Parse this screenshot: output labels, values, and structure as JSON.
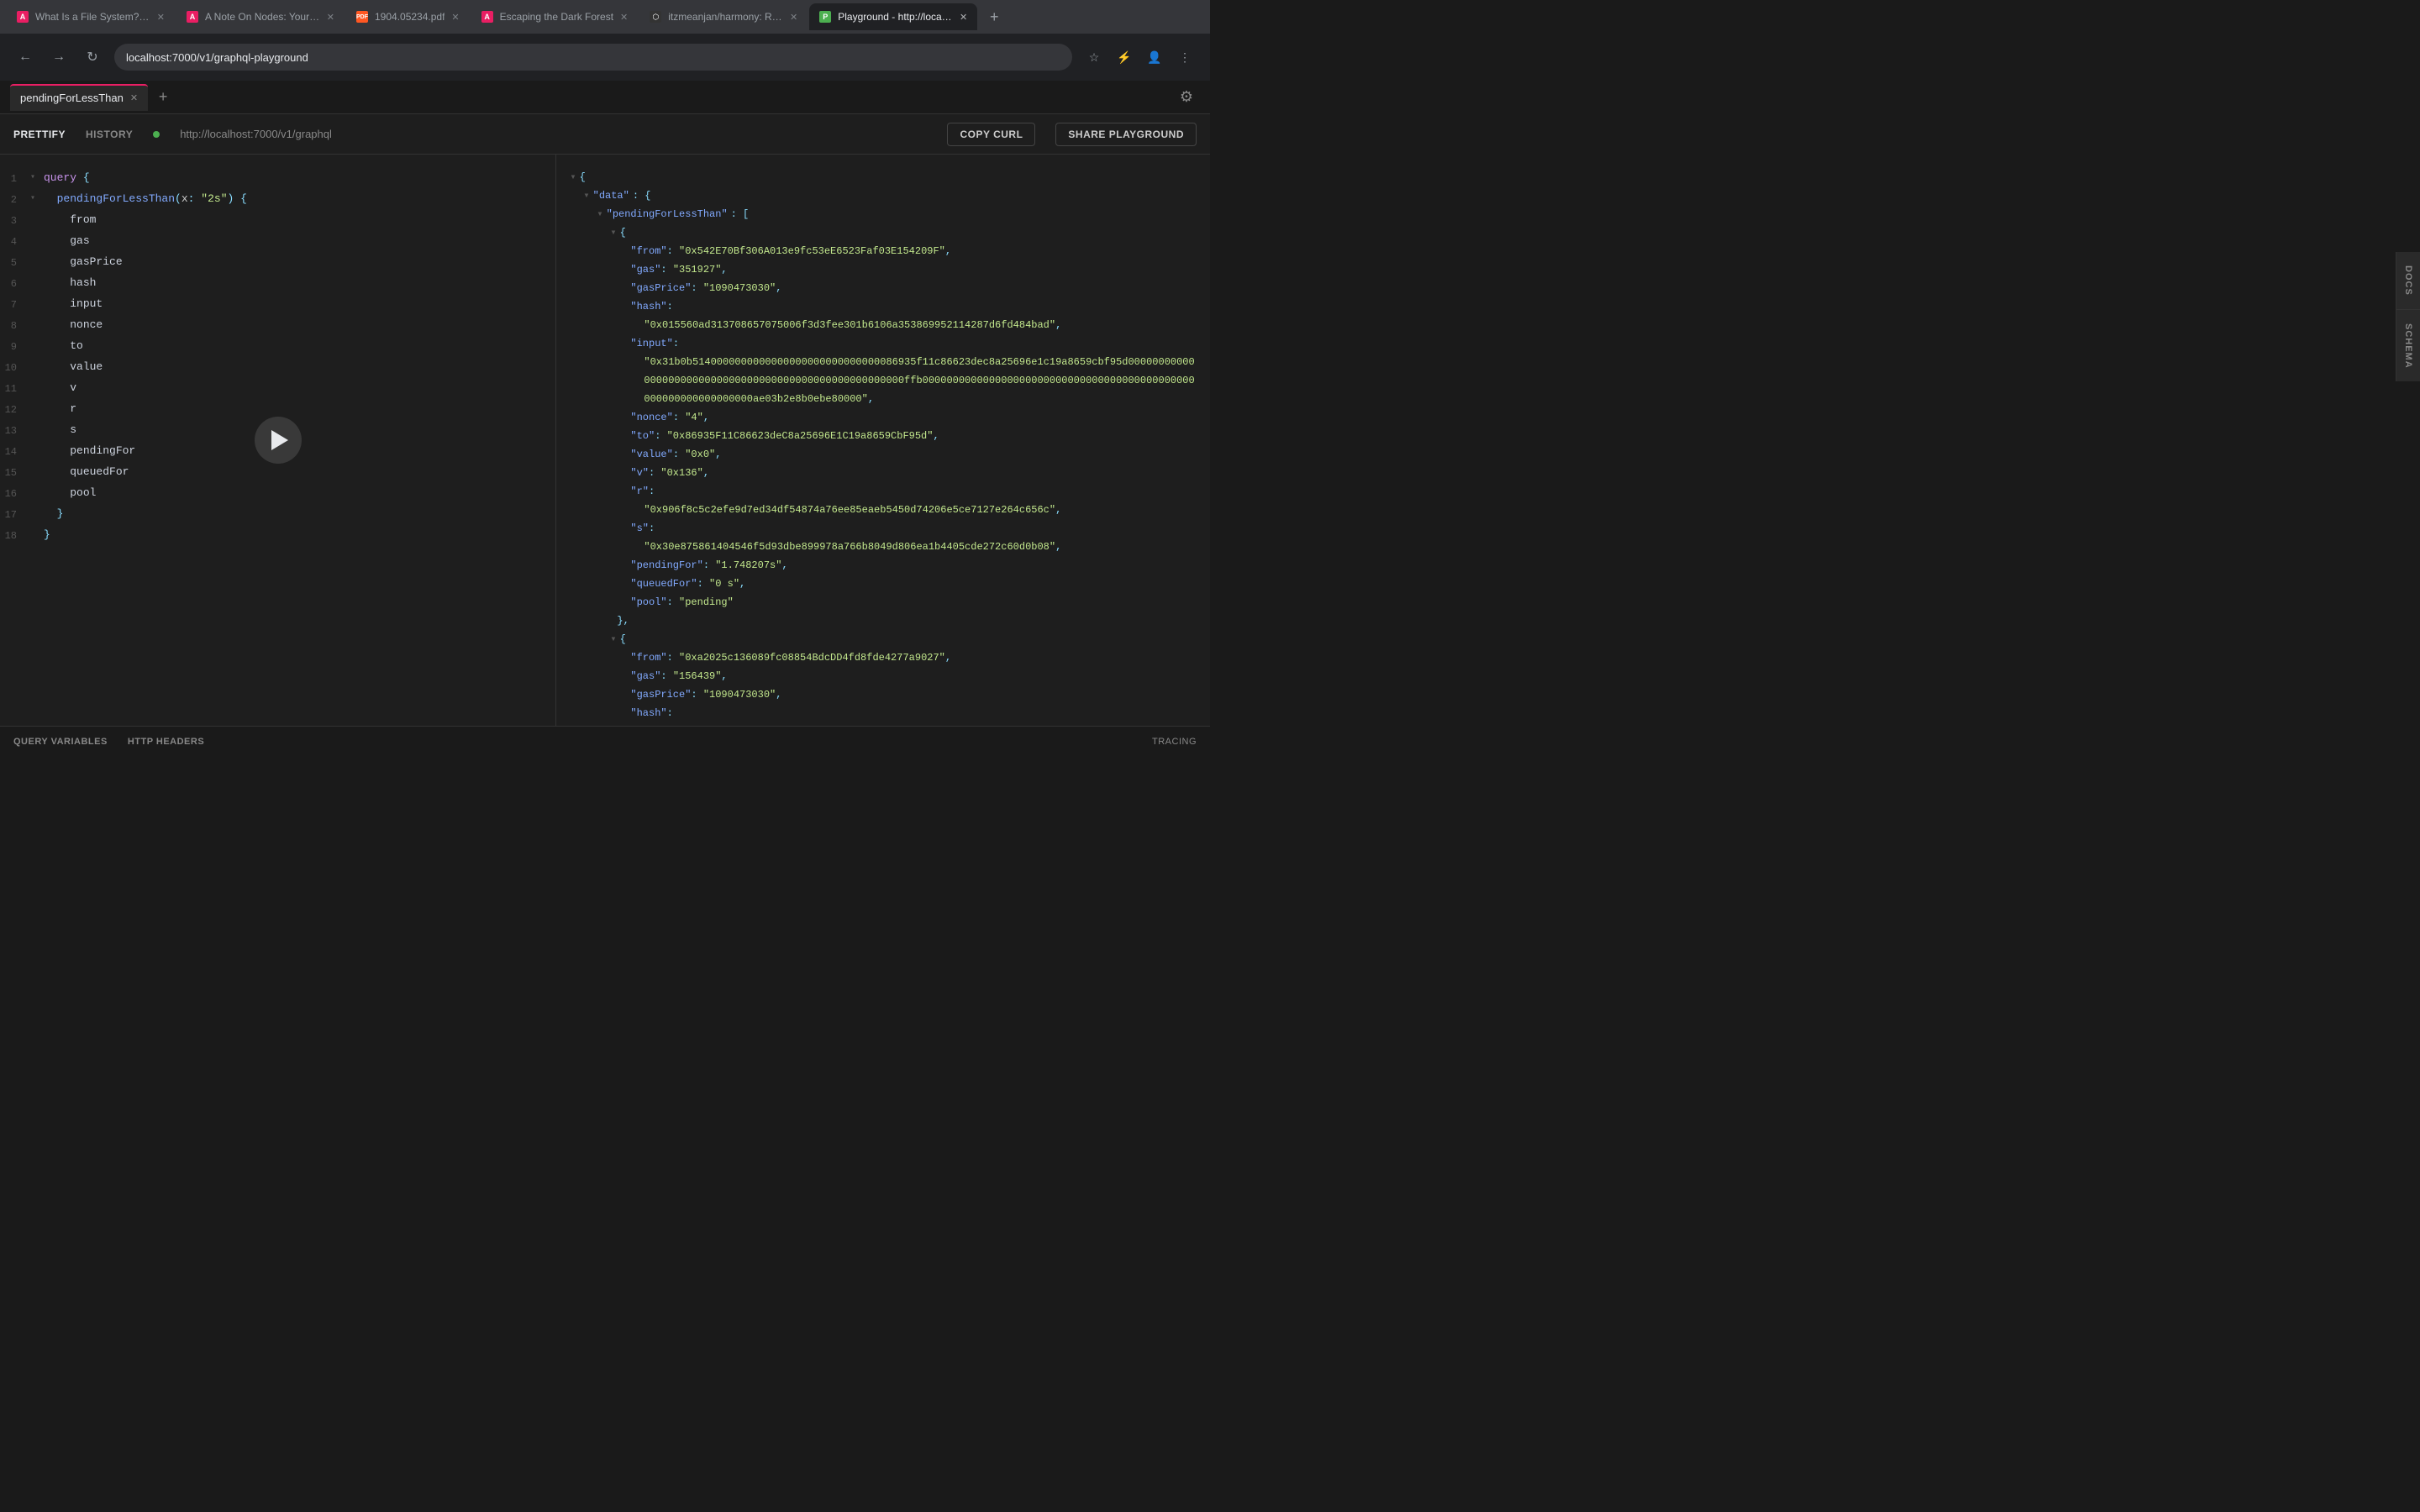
{
  "browser": {
    "url": "localhost:7000/v1/graphql-playground",
    "tabs": [
      {
        "id": "tab-1",
        "label": "What Is a File System? Type...",
        "favicon": "doc",
        "active": false
      },
      {
        "id": "tab-2",
        "label": "A Note On Nodes: Your Gate...",
        "favicon": "doc",
        "active": false
      },
      {
        "id": "tab-3",
        "label": "1904.05234.pdf",
        "favicon": "pdf",
        "active": false
      },
      {
        "id": "tab-4",
        "label": "Escaping the Dark Forest",
        "favicon": "doc",
        "active": false
      },
      {
        "id": "tab-5",
        "label": "itzmeanjan/harmony: Reduc...",
        "favicon": "gh",
        "active": false
      },
      {
        "id": "tab-6",
        "label": "Playground - http://localho...",
        "favicon": "playground",
        "active": true
      }
    ],
    "new_tab_label": "+"
  },
  "toolbar": {
    "prettify_label": "PRETTIFY",
    "history_label": "HISTORY",
    "endpoint_url": "http://localhost:7000/v1/graphql",
    "copy_curl_label": "COPY CURL",
    "share_playground_label": "SHARE PLAYGROUND"
  },
  "playground_tab": {
    "label": "pendingForLessThan",
    "add_label": "+"
  },
  "query": {
    "lines": [
      {
        "num": 1,
        "indent": 0,
        "collapse": "▾",
        "content": "query {"
      },
      {
        "num": 2,
        "indent": 1,
        "collapse": "▾",
        "content": "  pendingForLessThan(x: \"2s\") {"
      },
      {
        "num": 3,
        "indent": 2,
        "collapse": "",
        "content": "    from"
      },
      {
        "num": 4,
        "indent": 2,
        "collapse": "",
        "content": "    gas"
      },
      {
        "num": 5,
        "indent": 2,
        "collapse": "",
        "content": "    gasPrice"
      },
      {
        "num": 6,
        "indent": 2,
        "collapse": "",
        "content": "    hash"
      },
      {
        "num": 7,
        "indent": 2,
        "collapse": "",
        "content": "    input"
      },
      {
        "num": 8,
        "indent": 2,
        "collapse": "",
        "content": "    nonce"
      },
      {
        "num": 9,
        "indent": 2,
        "collapse": "",
        "content": "    to"
      },
      {
        "num": 10,
        "indent": 2,
        "collapse": "",
        "content": "    value"
      },
      {
        "num": 11,
        "indent": 2,
        "collapse": "",
        "content": "    v"
      },
      {
        "num": 12,
        "indent": 2,
        "collapse": "",
        "content": "    r"
      },
      {
        "num": 13,
        "indent": 2,
        "collapse": "",
        "content": "    s"
      },
      {
        "num": 14,
        "indent": 2,
        "collapse": "",
        "content": "    pendingFor"
      },
      {
        "num": 15,
        "indent": 2,
        "collapse": "",
        "content": "    queuedFor"
      },
      {
        "num": 16,
        "indent": 2,
        "collapse": "",
        "content": "    pool"
      },
      {
        "num": 17,
        "indent": 1,
        "collapse": "",
        "content": "  }"
      },
      {
        "num": 18,
        "indent": 0,
        "collapse": "",
        "content": "}"
      }
    ]
  },
  "result": {
    "lines": [
      "{",
      "  \"data\": {",
      "    \"pendingForLessThan\": [",
      "      {",
      "        \"from\": \"0x542E70Bf306A013e9fc53eE6523Faf03E154209F\",",
      "        \"gas\": \"351927\",",
      "        \"gasPrice\": \"1090473030\",",
      "        \"hash\":",
      "\"0x015560ad313708657075006f3d3fee301b6106a353869952114287d6fd484bad\",",
      "        \"input\":",
      "\"0x31b0b5140000000000000000000000000000086935f11c86623dec8a25696e1c19a8659cbf95d000000000000000000000000000000000000000000000000000000ffb000000000000000000000000000000000000000000000000000000000000000ae03b2e8b0ebe80000\",",
      "        \"nonce\": \"4\",",
      "        \"to\": \"0x86935F11C86623deC8a25696E1C19a8659CbF95d\",",
      "        \"value\": \"0x0\",",
      "        \"v\": \"0x136\",",
      "        \"r\":",
      "\"0x906f8c5c2efe9d7ed34df54874a76ee85eaeb5450d74206e5ce7127e264c656c\",",
      "        \"s\":",
      "\"0x30e875861404546f5d93dbe899978a766b8049d806ea1b4405cde272c60d0b08\",",
      "        \"pendingFor\": \"1.748207s\",",
      "        \"queuedFor\": \"0 s\",",
      "        \"pool\": \"pending\"",
      "      },",
      "      {",
      "        \"from\": \"0xa2025c136089fc08854BdcDD4fd8fde4277a9027\",",
      "        \"gas\": \"156439\",",
      "        \"gasPrice\": \"1090473030\",",
      "        \"hash\":"
    ]
  },
  "side_tabs": {
    "docs_label": "DOCS",
    "schema_label": "SCHEMA"
  },
  "bottom_bar": {
    "query_variables_label": "QUERY VARIABLES",
    "http_headers_label": "HTTP HEADERS",
    "tracing_label": "TRACING"
  }
}
